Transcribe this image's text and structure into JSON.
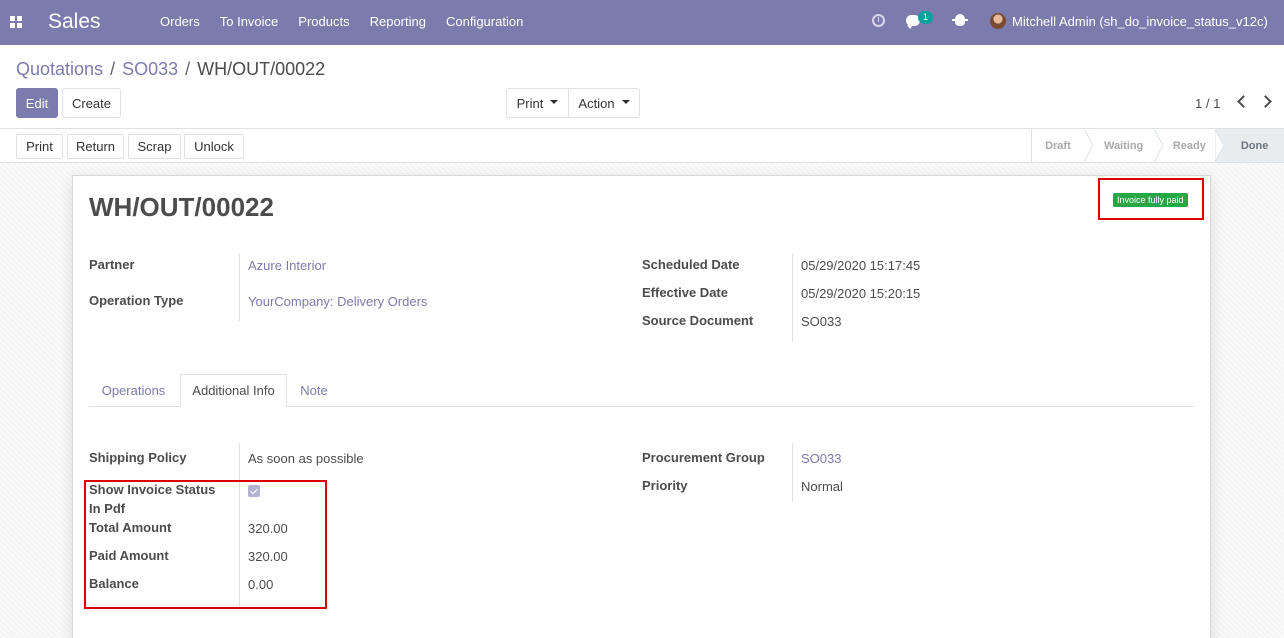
{
  "navbar": {
    "brand": "Sales",
    "menu": [
      "Orders",
      "To Invoice",
      "Products",
      "Reporting",
      "Configuration"
    ],
    "chat_count": "1",
    "user": "Mitchell Admin (sh_do_invoice_status_v12c)"
  },
  "breadcrumb": {
    "first": "Quotations",
    "second": "SO033",
    "current": "WH/OUT/00022",
    "separator": "/"
  },
  "controls": {
    "edit": "Edit",
    "create": "Create",
    "print": "Print",
    "action": "Action",
    "pager": "1 / 1"
  },
  "header_buttons": {
    "print": "Print",
    "return": "Return",
    "scrap": "Scrap",
    "unlock": "Unlock"
  },
  "statusbar": [
    "Draft",
    "Waiting",
    "Ready",
    "Done"
  ],
  "form": {
    "title": "WH/OUT/00022",
    "badge": "Invoice fully paid",
    "partner_label": "Partner",
    "partner": "Azure Interior",
    "operation_type_label": "Operation Type",
    "operation_type": "YourCompany: Delivery Orders",
    "scheduled_date_label": "Scheduled Date",
    "scheduled_date": "05/29/2020 15:17:45",
    "effective_date_label": "Effective Date",
    "effective_date": "05/29/2020 15:20:15",
    "source_document_label": "Source Document",
    "source_document": "SO033"
  },
  "tabs": [
    "Operations",
    "Additional Info",
    "Note"
  ],
  "additional_info": {
    "shipping_policy_label": "Shipping Policy",
    "shipping_policy": "As soon as possible",
    "show_invoice_label_line1": "Show Invoice Status",
    "show_invoice_label_line2": "In Pdf",
    "total_amount_label": "Total Amount",
    "total_amount": "320.00",
    "paid_amount_label": "Paid Amount",
    "paid_amount": "320.00",
    "balance_label": "Balance",
    "balance": "0.00",
    "procurement_group_label": "Procurement Group",
    "procurement_group": "SO033",
    "priority_label": "Priority",
    "priority": "Normal"
  },
  "colors": {
    "brand": "#7c7bad",
    "badge": "#28a745",
    "highlight": "#dd0000"
  }
}
